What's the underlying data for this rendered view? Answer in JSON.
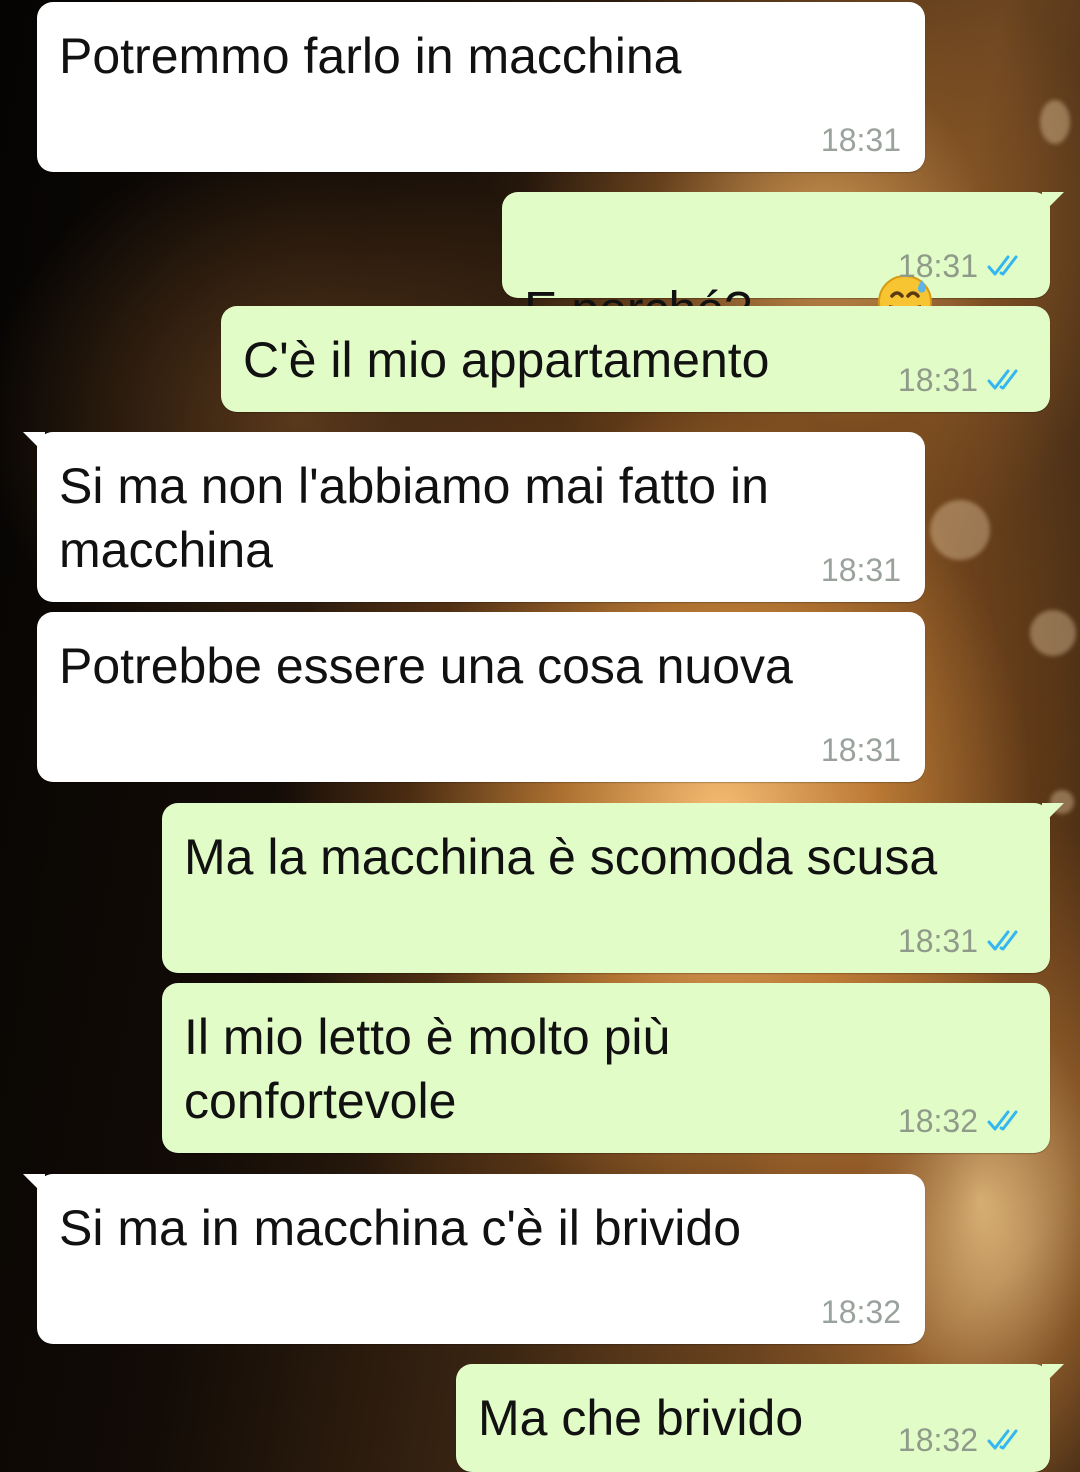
{
  "theme": {
    "incoming_color": "#ffffff",
    "outgoing_color": "#e1fcc7",
    "read_tick_color": "#34b7f1",
    "timestamp_color": "#9aa29c"
  },
  "messages": [
    {
      "direction": "incoming",
      "text": "Potremmo farlo in macchina",
      "time": "18:31"
    },
    {
      "direction": "outgoing",
      "text": "E perché?",
      "emoji": "grinning-face-with-sweat-emoji",
      "time": "18:31",
      "status": "read"
    },
    {
      "direction": "outgoing",
      "text": "C'è il mio appartamento",
      "time": "18:31",
      "status": "read"
    },
    {
      "direction": "incoming",
      "text": "Si ma non l'abbiamo mai fatto in\nmacchina",
      "time": "18:31"
    },
    {
      "direction": "incoming",
      "text": "Potrebbe essere una cosa nuova",
      "time": "18:31"
    },
    {
      "direction": "outgoing",
      "text": "Ma la macchina è scomoda scusa",
      "time": "18:31",
      "status": "read"
    },
    {
      "direction": "outgoing",
      "text": "Il mio letto è molto più\nconfortevole",
      "time": "18:32",
      "status": "read"
    },
    {
      "direction": "incoming",
      "text": "Si ma in macchina c'è il brivido",
      "time": "18:32"
    },
    {
      "direction": "outgoing",
      "text": "Ma che brivido",
      "time": "18:32",
      "status": "read"
    }
  ]
}
